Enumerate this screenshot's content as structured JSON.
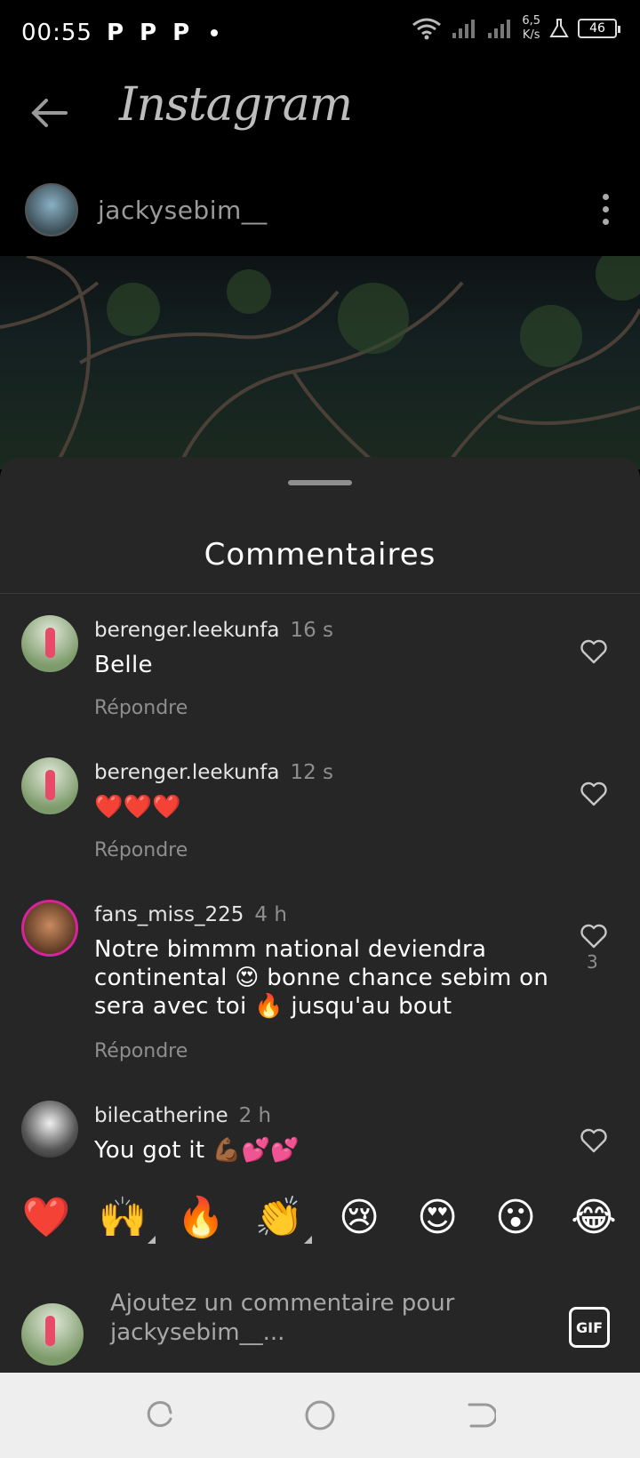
{
  "status_bar": {
    "time": "00:55",
    "notif_icons": [
      "P",
      "P",
      "P"
    ],
    "net_speed_value": "6,5",
    "net_speed_unit": "K/s",
    "battery": "46"
  },
  "app_bar": {
    "logo": "Instagram",
    "post_username": "jackysebim__"
  },
  "sheet": {
    "title": "Commentaires"
  },
  "comments": [
    {
      "username": "berenger.leekunfa",
      "time": "16 s",
      "text": "Belle",
      "reply": "Répondre",
      "likes": ""
    },
    {
      "username": "berenger.leekunfa",
      "time": "12 s",
      "text": "❤️❤️❤️",
      "reply": "Répondre",
      "likes": ""
    },
    {
      "username": "fans_miss_225",
      "time": "4 h",
      "text": "Notre bimmm national deviendra continental 😍 bonne chance sebim on sera avec toi 🔥 jusqu'au bout",
      "reply": "Répondre",
      "likes": "3"
    },
    {
      "username": "bilecatherine",
      "time": "2 h",
      "text": "You got it 💪🏾💕💕",
      "reply": "",
      "likes": ""
    }
  ],
  "emoji_bar": [
    "❤️",
    "🙌",
    "🔥",
    "👏",
    "😢",
    "😍",
    "😮",
    "😂"
  ],
  "composer": {
    "placeholder": "Ajoutez un commentaire pour jackysebim__...",
    "gif_label": "GIF"
  },
  "colors": {
    "sheet_bg": "#262626",
    "secondary_text": "#8e8e8e",
    "nav_bg": "#eeeeee"
  }
}
